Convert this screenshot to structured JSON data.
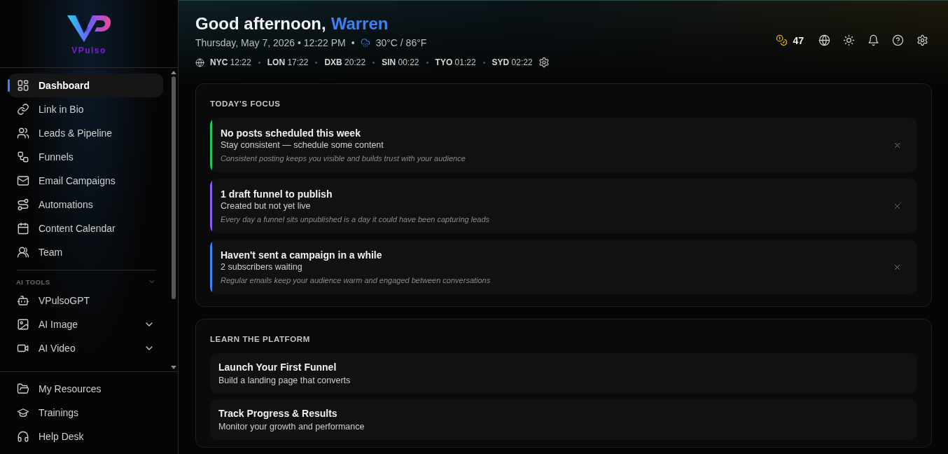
{
  "sidebar": {
    "brand": "VPulso",
    "nav": [
      {
        "label": "Dashboard",
        "selected": true
      },
      {
        "label": "Link in Bio",
        "selected": false
      },
      {
        "label": "Leads & Pipeline",
        "selected": false
      },
      {
        "label": "Funnels",
        "selected": false
      },
      {
        "label": "Email Campaigns",
        "selected": false
      },
      {
        "label": "Automations",
        "selected": false
      },
      {
        "label": "Content Calendar",
        "selected": false
      },
      {
        "label": "Team",
        "selected": false
      }
    ],
    "ai_tools": {
      "title": "AI TOOLS",
      "items": [
        {
          "label": "VPulsoGPT",
          "kind": "link",
          "selected": false
        },
        {
          "label": "AI Image",
          "kind": "submenu",
          "selected": false
        },
        {
          "label": "AI Video",
          "kind": "submenu",
          "selected": false
        }
      ]
    },
    "footer_items": [
      {
        "label": "My Resources",
        "selected": false
      },
      {
        "label": "Trainings",
        "selected": false
      },
      {
        "label": "Help Desk",
        "selected": false
      }
    ]
  },
  "header": {
    "greeting": "Good afternoon,",
    "user_name": "Warren",
    "date_time": "Thursday, May 7, 2026 • 12:22 PM",
    "separator": "•",
    "weather": "30°C / 86°F",
    "clocks": [
      {
        "city": "NYC",
        "time": "12:22"
      },
      {
        "city": "LON",
        "time": "17:22"
      },
      {
        "city": "DXB",
        "time": "20:22"
      },
      {
        "city": "SIN",
        "time": "00:22"
      },
      {
        "city": "TYO",
        "time": "01:22"
      },
      {
        "city": "SYD",
        "time": "02:22"
      }
    ],
    "credits": "47"
  },
  "focus": {
    "title": "TODAY'S FOCUS",
    "items": [
      {
        "title": "No posts scheduled this week",
        "subtitle": "Stay consistent — schedule some content",
        "note": "Consistent posting keeps you visible and builds trust with your audience",
        "color": "#22c55e"
      },
      {
        "title": "1 draft funnel to publish",
        "subtitle": "Created but not yet live",
        "note": "Every day a funnel sits unpublished is a day it could have been capturing leads",
        "color": "#8b5cf6"
      },
      {
        "title": "Haven't sent a campaign in a while",
        "subtitle": "2 subscribers waiting",
        "note": "Regular emails keep your audience warm and engaged between conversations",
        "color": "#3b82f6"
      }
    ]
  },
  "learn": {
    "title": "LEARN THE PLATFORM",
    "items": [
      {
        "title": "Launch Your First Funnel",
        "subtitle": "Build a landing page that converts"
      },
      {
        "title": "Track Progress & Results",
        "subtitle": "Monitor your growth and performance"
      }
    ]
  }
}
